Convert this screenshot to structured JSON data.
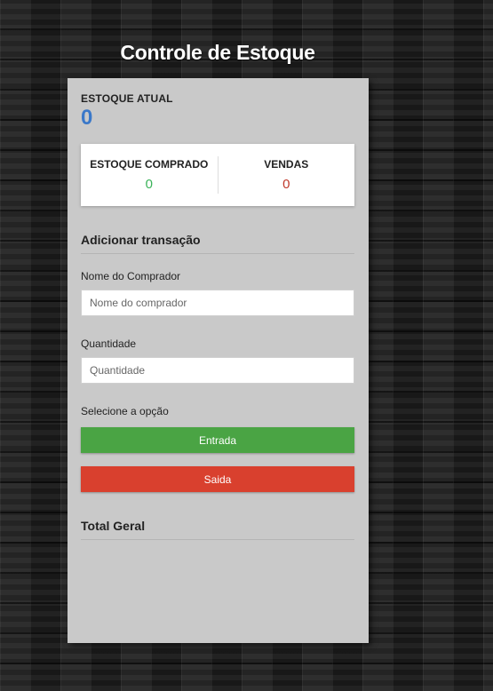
{
  "app": {
    "title": "Controle de Estoque"
  },
  "balance": {
    "label": "ESTOQUE ATUAL",
    "value": "0",
    "color": "#3a78c9"
  },
  "summary": {
    "purchased_label": "ESTOQUE COMPRADO",
    "purchased_value": "0",
    "sales_label": "VENDAS",
    "sales_value": "0"
  },
  "transaction": {
    "heading": "Adicionar transação",
    "buyer_label": "Nome do Comprador",
    "buyer_placeholder": "Nome do comprador",
    "buyer_value": "",
    "quantity_label": "Quantidade",
    "quantity_placeholder": "Quantidade",
    "quantity_value": "",
    "option_label": "Selecione a opção",
    "entrada_label": "Entrada",
    "saida_label": "Saida"
  },
  "total": {
    "heading": "Total Geral"
  },
  "colors": {
    "entrada": "#4aa444",
    "saida": "#d9402e",
    "panel": "#c9c9c9",
    "positive": "#3cb35a",
    "negative": "#c0392b"
  }
}
